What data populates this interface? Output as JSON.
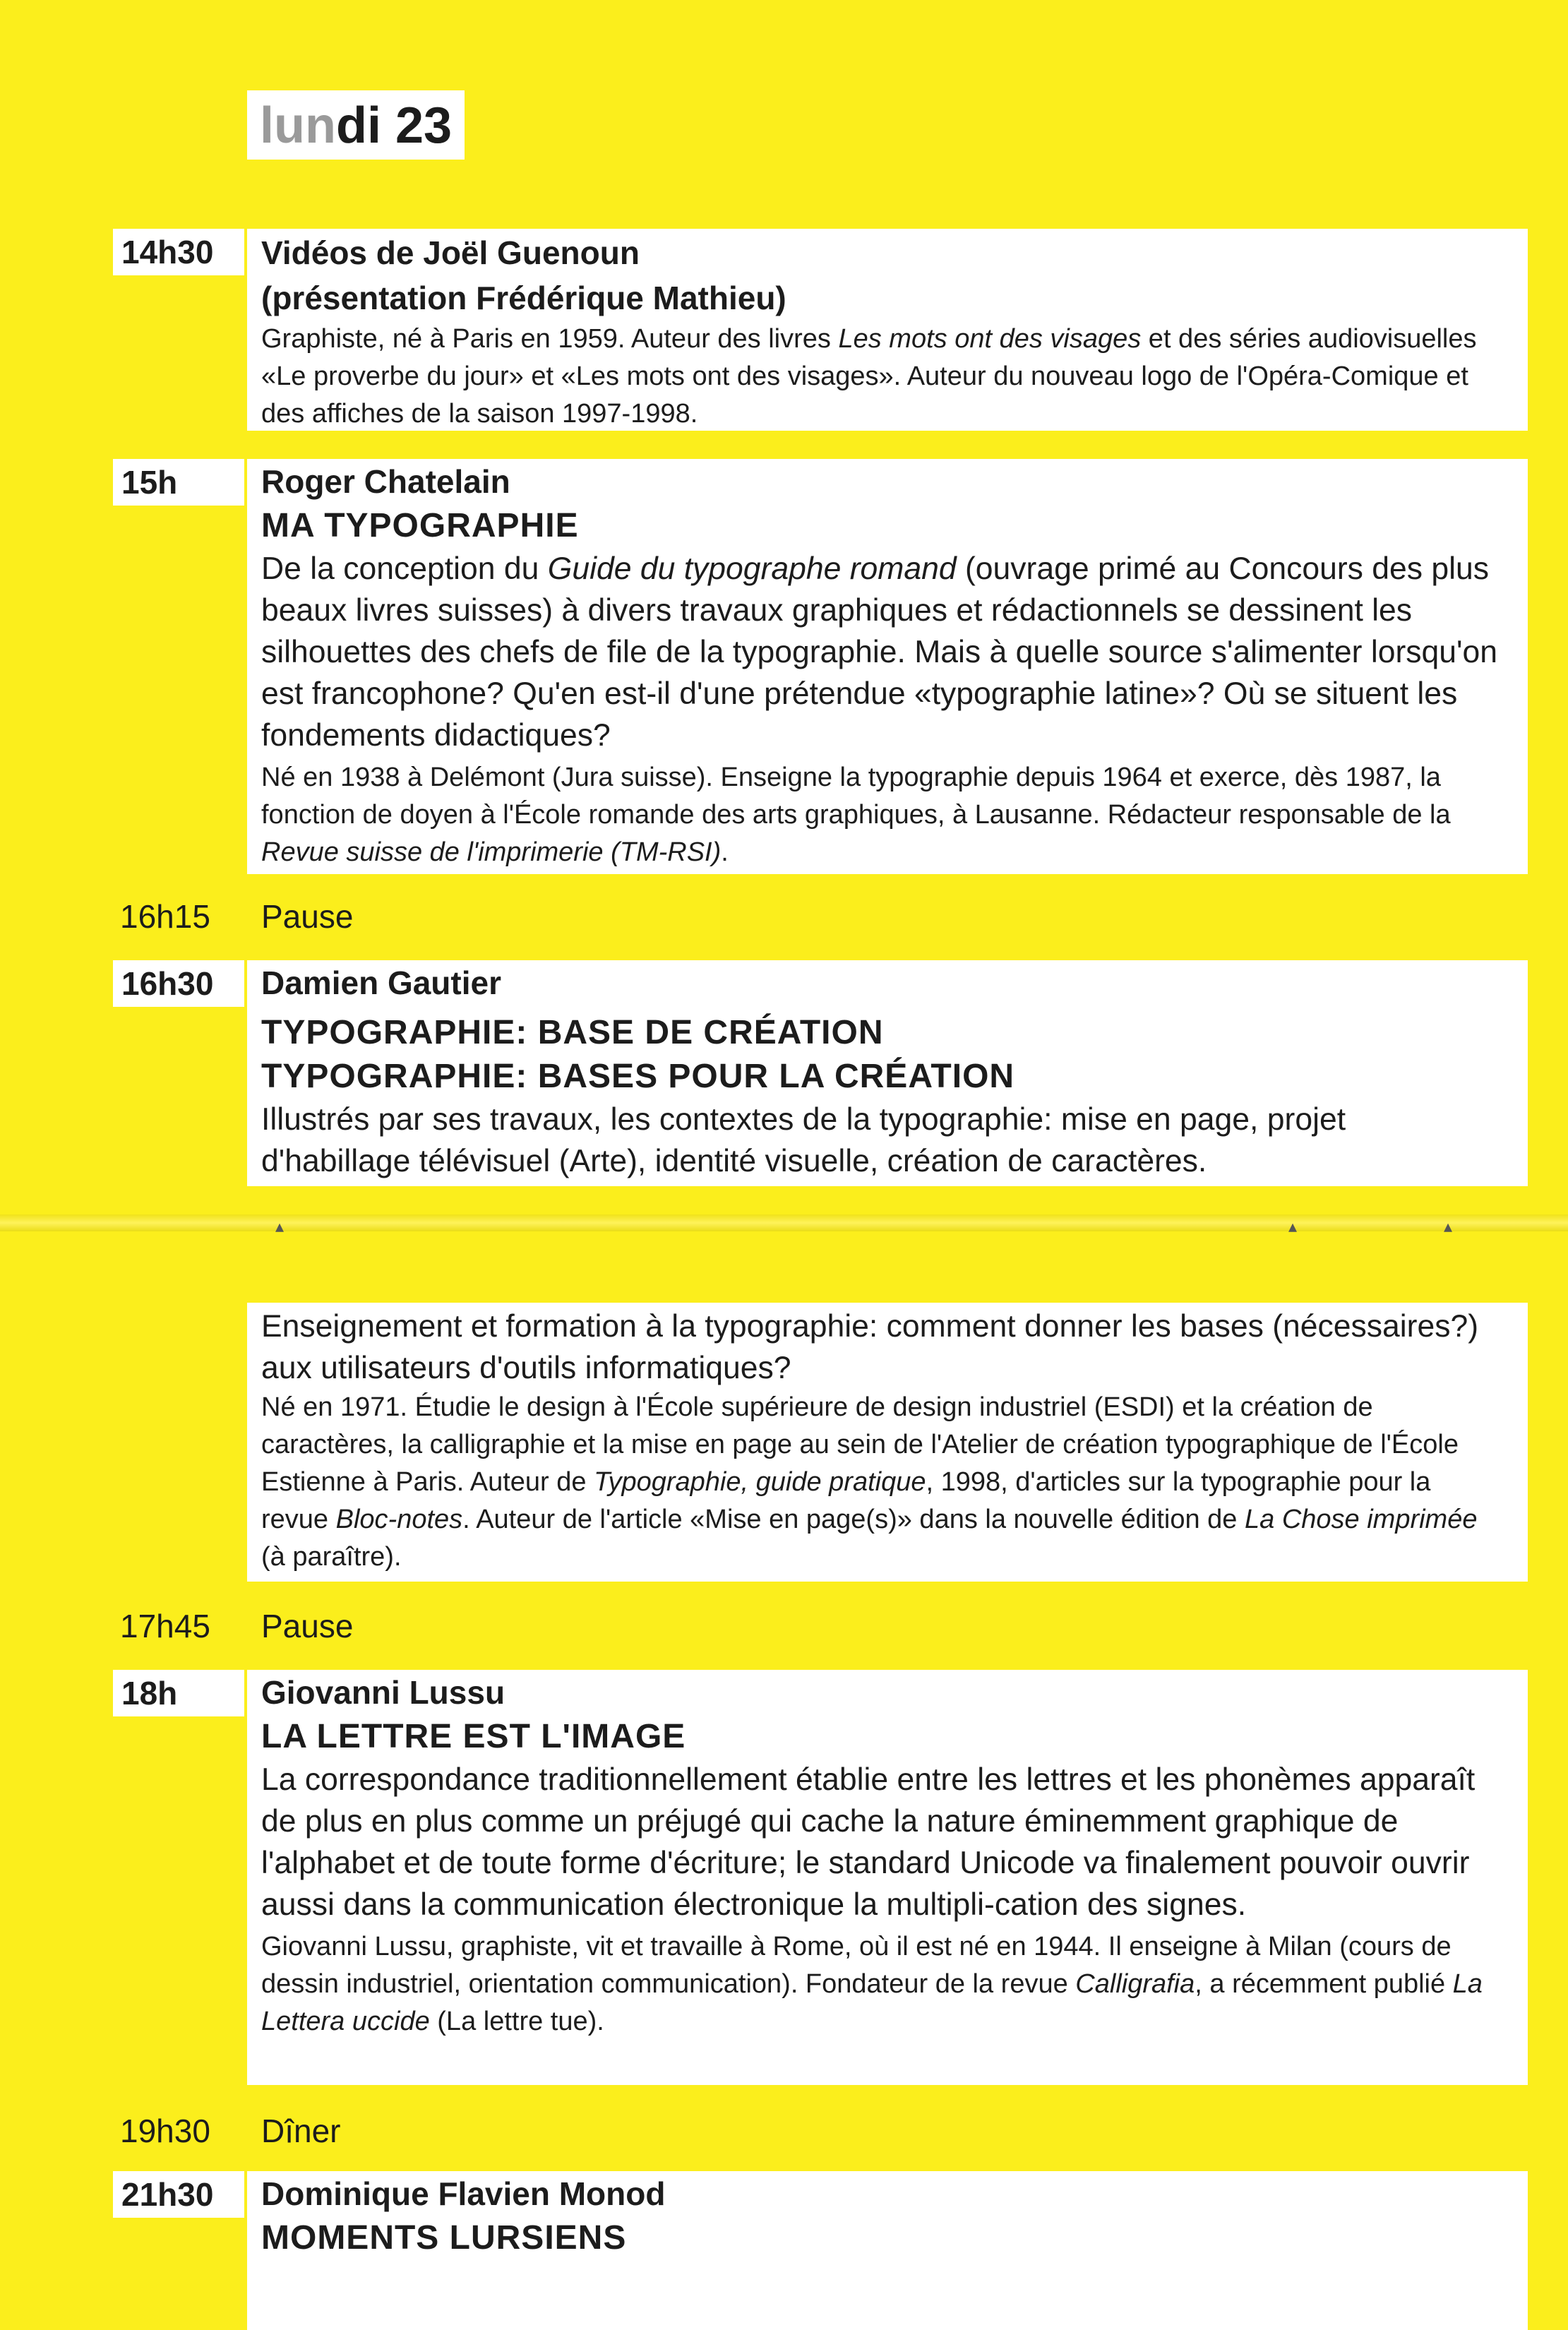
{
  "day": {
    "faded": "lun",
    "rest": "di 23"
  },
  "sessions": [
    {
      "time": "14h30",
      "speaker": "Vidéos de Joël Guenoun",
      "speaker2": "(présentation Frédérique Mathieu)",
      "bio": [
        "Graphiste, né à Paris en 1959. Auteur des livres ",
        "Les mots ont des visages",
        " et des séries audiovisuelles «Le proverbe du jour» et «Les mots ont des visages». Auteur du nouveau logo de l'Opéra-Comique et des affiches de la saison 1997-1998."
      ]
    },
    {
      "time": "15h",
      "speaker": "Roger Chatelain",
      "title": "MA TYPOGRAPHIE",
      "lead": [
        "De la conception du ",
        "Guide du typographe romand",
        " (ouvrage primé au Concours des plus beaux livres suisses) à divers travaux graphiques et rédactionnels se dessinent les silhouettes des chefs de file de la typographie. Mais à quelle source s'alimenter lorsqu'on est francophone? Qu'en est-il d'une prétendue «typographie latine»? Où se situent les fondements didactiques?"
      ],
      "bio": [
        "Né en 1938 à Delémont (Jura suisse). Enseigne la typographie depuis 1964 et exerce, dès 1987, la fonction de doyen à l'École romande des arts graphiques, à Lausanne. Rédacteur responsable de la ",
        "Revue suisse de l'imprimerie (TM-RSI)",
        "."
      ]
    },
    {
      "time": "16h30",
      "speaker": "Damien Gautier",
      "title": "TYPOGRAPHIE: BASE DE CRÉATION",
      "title2": "TYPOGRAPHIE: BASES POUR LA CRÉATION",
      "lead": "Illustrés par ses travaux, les contextes de la typographie: mise en page, projet d'habillage télévisuel (Arte), identité visuelle, création de caractères.",
      "lead_cont": "Enseignement et formation à la typographie: comment donner les bases (nécessaires?) aux utilisateurs d'outils informatiques?",
      "bio": [
        "Né en 1971. Étudie le design à l'École supérieure de design industriel (ESDI) et la création de caractères, la calligraphie et la mise en page au sein de l'Atelier de création typographique de l'École Estienne à Paris. Auteur de ",
        "Typographie, guide pratique",
        ", 1998, d'articles sur la typographie pour la revue ",
        "Bloc-notes",
        ". Auteur de l'article «Mise en page(s)» dans la nouvelle édition de ",
        "La Chose imprimée",
        " (à paraître)."
      ]
    },
    {
      "time": "18h",
      "speaker": "Giovanni Lussu",
      "title": "LA LETTRE EST L'IMAGE",
      "lead": "La correspondance traditionnellement établie entre les lettres et les phonèmes apparaît de plus en plus comme un préjugé qui cache la nature éminemment graphique de l'alphabet et de toute forme d'écriture; le standard Unicode va finalement pouvoir ouvrir aussi dans la communication électronique la multipli-cation des signes.",
      "bio": [
        "Giovanni Lussu, graphiste, vit et travaille à Rome, où il est né en 1944. Il enseigne à Milan (cours de dessin industriel, orientation communication). Fondateur de la revue ",
        "Calligrafia",
        ", a récemment publié ",
        "La Lettera uccide",
        " (La lettre tue)."
      ]
    },
    {
      "time": "21h30",
      "speaker": "Dominique Flavien Monod",
      "title": "MOMENTS LURSIENS"
    }
  ],
  "breaks": [
    {
      "time": "16h15",
      "label": "Pause"
    },
    {
      "time": "17h45",
      "label": "Pause"
    },
    {
      "time": "19h30",
      "label": "Dîner"
    }
  ]
}
